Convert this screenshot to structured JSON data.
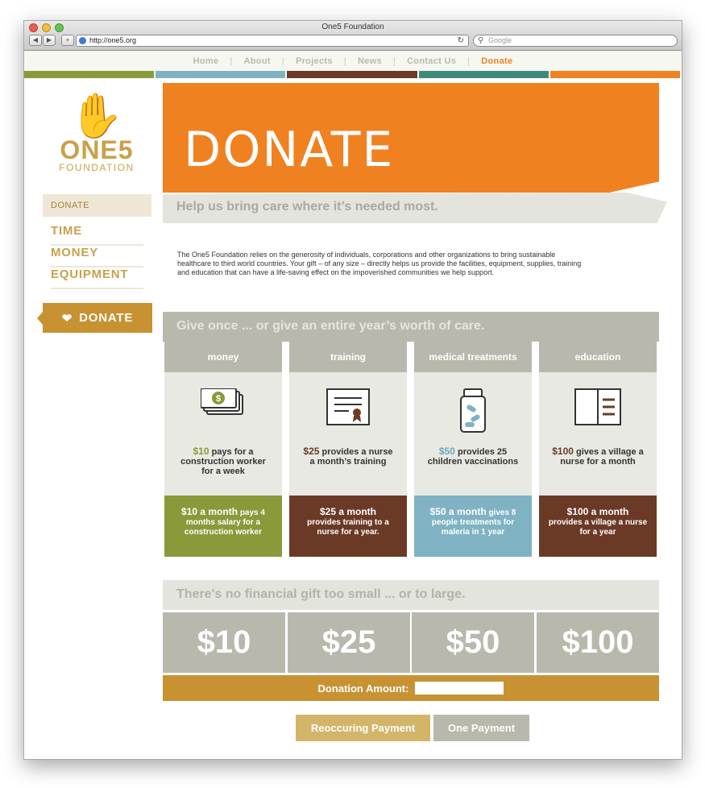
{
  "window": {
    "title": "One5 Foundation"
  },
  "browser": {
    "url": "http://one5.org",
    "search_placeholder": "Google"
  },
  "nav": [
    "Home",
    "About",
    "Projects",
    "News",
    "Contact Us",
    "Donate"
  ],
  "stripe_colors": [
    "#8a9a3a",
    "#7fb3c3",
    "#6b3a26",
    "#3e8a7a",
    "#f08121"
  ],
  "logo": {
    "name": "ONE5",
    "sub": "FOUNDATION"
  },
  "sidebar": {
    "active": "DONATE",
    "links": [
      "TIME",
      "MONEY",
      "EQUIPMENT"
    ],
    "donate_button": "DONATE"
  },
  "hero": {
    "title": "DONATE"
  },
  "tagline": "Help us bring care where it’s needed most.",
  "intro": "The One5 Foundation relies on the generosity of individuals, corporations and other organizations to bring sustainable healthcare to third world countries. Your gift – of any size – directly helps us provide the facilities, equipment, supplies, training and education that can have a life-saving effect on the impoverished communities we help support.",
  "give_band": "Give once ... or give an entire year’s worth of care.",
  "cards": [
    {
      "head": "money",
      "icon": "cash-icon",
      "amount": "$10",
      "amount_color": "#8a9a3a",
      "text": "pays for a construction worker for a week",
      "foot_amt": "$10 a month",
      "foot_text": "pays 4 months salary for a construction worker",
      "foot_color": "#8a9a3a"
    },
    {
      "head": "training",
      "icon": "certificate-icon",
      "amount": "$25",
      "amount_color": "#6b3a26",
      "text": "provides a nurse a month’s training",
      "foot_amt": "$25 a month",
      "foot_text": "provides training to a nurse for a year.",
      "foot_color": "#6b3a26"
    },
    {
      "head": "medical treatments",
      "icon": "pill-bottle-icon",
      "amount": "$50",
      "amount_color": "#6aa9bd",
      "text": "provides 25 children vaccinations",
      "foot_amt": "$50 a month",
      "foot_text": "gives 8 people treatments for maleria in 1 year",
      "foot_color": "#7fb3c3"
    },
    {
      "head": "education",
      "icon": "book-icon",
      "amount": "$100",
      "amount_color": "#6b3a26",
      "text": "gives a village a nurse for a month",
      "foot_amt": "$100 a month",
      "foot_text": "provides a village a nurse for a year",
      "foot_color": "#6b3a26"
    }
  ],
  "gift_band": "There's no financial gift too small ... or to large.",
  "amounts": [
    "$10",
    "$25",
    "$50",
    "$100"
  ],
  "donation_label": "Donation Amount:",
  "donation_value": "",
  "buttons": {
    "recurring": "Reoccuring Payment",
    "once": "One Payment"
  }
}
